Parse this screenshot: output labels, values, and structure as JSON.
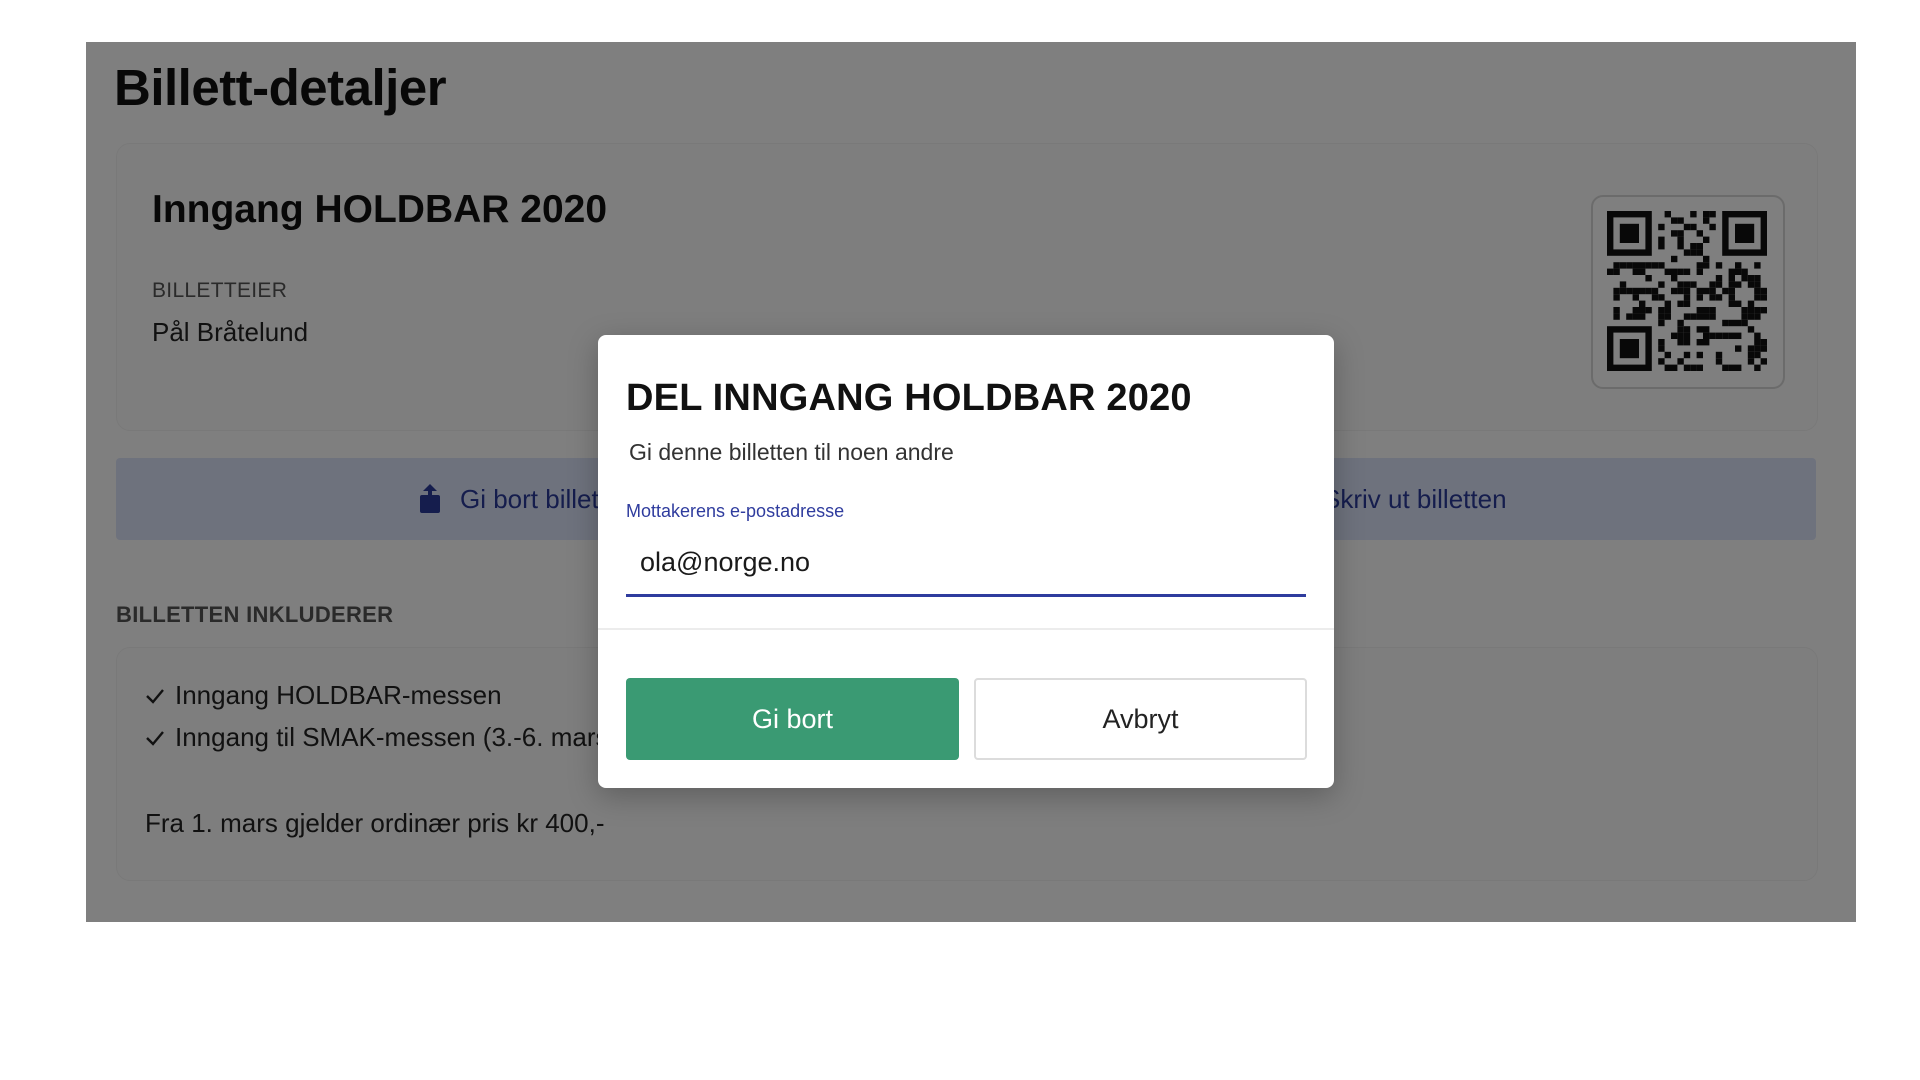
{
  "page": {
    "title": "Billett-detaljer"
  },
  "ticket": {
    "name": "Inngang HOLDBAR 2020",
    "owner_label": "BILLETTEIER",
    "owner_name": "Pål Bråtelund",
    "qr_icon": "qr-code-icon"
  },
  "actions": {
    "give_away_label": "Gi bort billetten",
    "print_label": "Skriv ut billetten",
    "give_away_icon": "share-icon",
    "print_icon": "printer-icon",
    "color": "#2a3a9a"
  },
  "includes": {
    "heading": "BILLETTEN INKLUDERER",
    "items": [
      "Inngang HOLDBAR-messen",
      "Inngang til SMAK-messen (3.-6. mars)"
    ],
    "note": "Fra 1. mars gjelder ordinær pris kr 400,-"
  },
  "modal": {
    "title": "DEL INNGANG HOLDBAR 2020",
    "subtitle": "Gi denne billetten til noen andre",
    "email_label": "Mottakerens e-postadresse",
    "email_value": "ola@norge.no",
    "confirm_label": "Gi bort",
    "cancel_label": "Avbryt",
    "confirm_color": "#3a9a73",
    "accent_color": "#2f3c9e"
  }
}
